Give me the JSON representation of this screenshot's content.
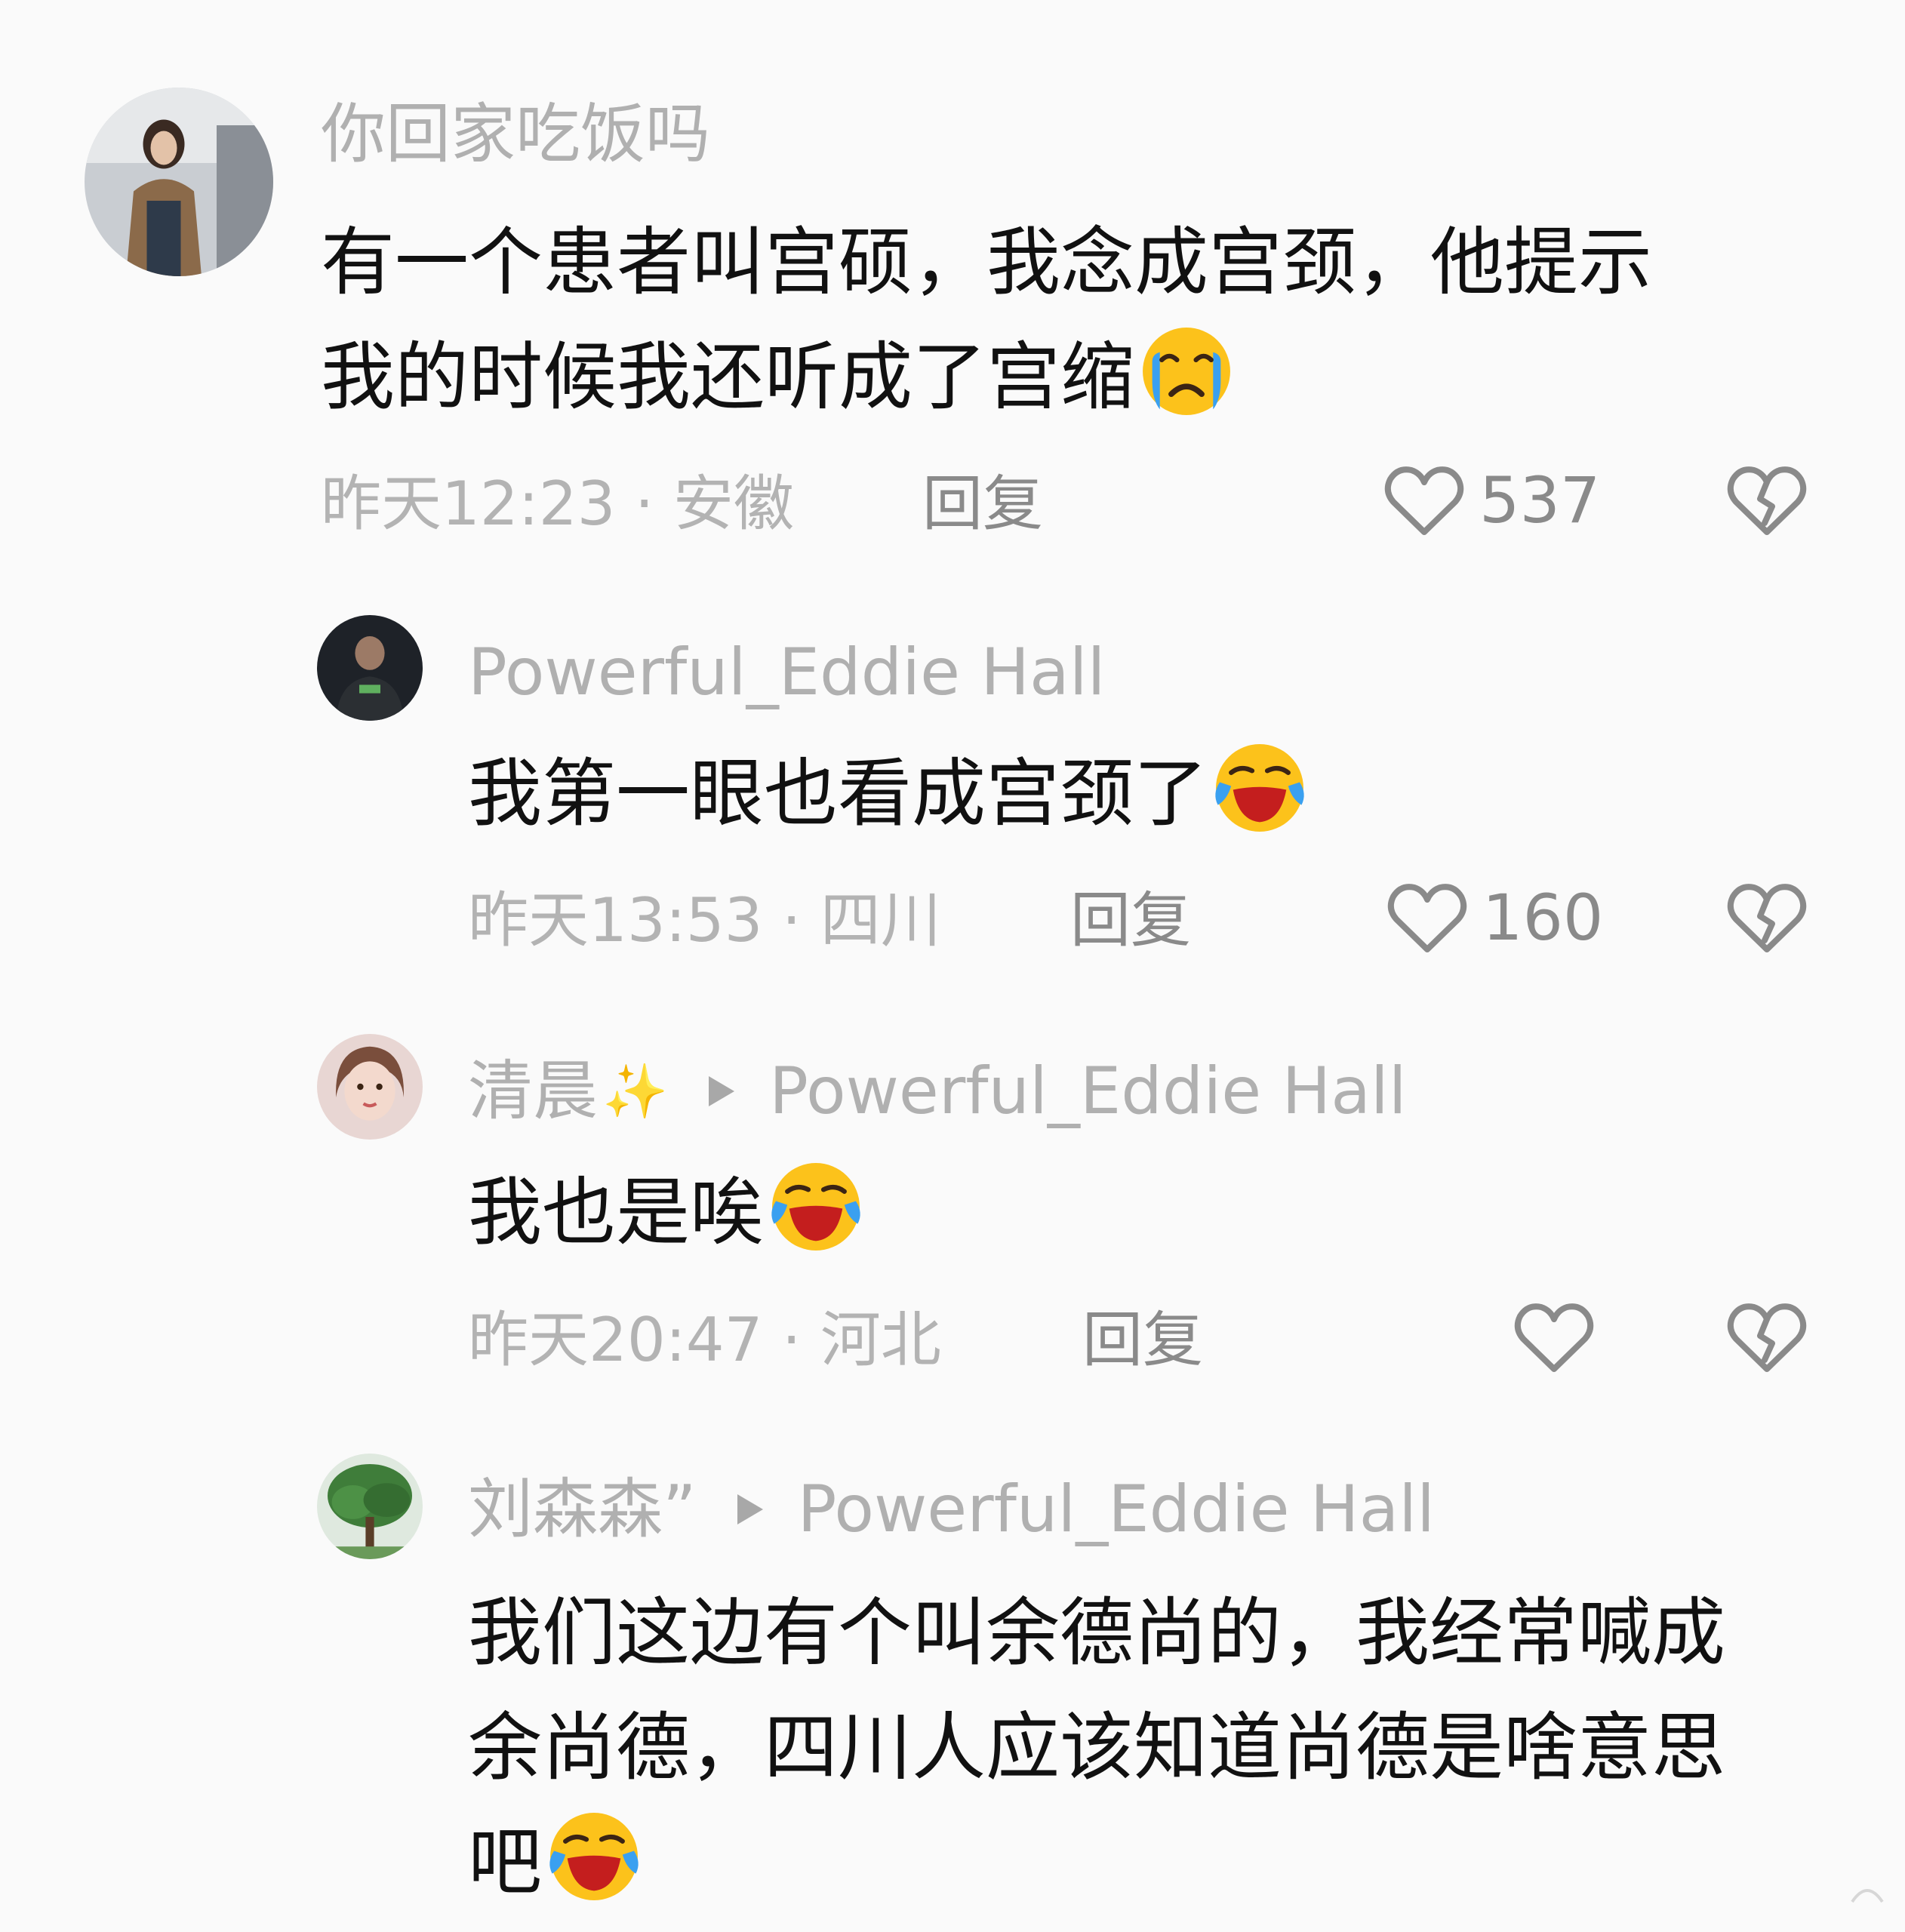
{
  "colors": {
    "background": "#fafafa",
    "username": "#b0b0b0",
    "body_text": "#111111",
    "meta": "#b3b3b3",
    "action": "#8a8a8a"
  },
  "comments": [
    {
      "username": "你回家吃饭吗",
      "text_lines": [
        "有一个患者叫宫硕，我念成宫颈，他提示",
        "我的时候我还听成了宫缩"
      ],
      "emoji": "loudly-crying-face-icon",
      "meta": "昨天12:23 · 安徽",
      "reply_label": "回复",
      "likes": "537"
    },
    {
      "username": "Powerful_Eddie Hall",
      "text_lines": [
        "我第一眼也看成宫颈了"
      ],
      "emoji": "rolling-laughing-face-icon",
      "meta": "昨天13:53 · 四川",
      "reply_label": "回复",
      "likes": "160"
    },
    {
      "username": "清晨",
      "username_suffix": "✨",
      "reply_to": "Powerful_Eddie Hall",
      "text_lines": [
        "我也是唉"
      ],
      "emoji": "rolling-laughing-face-icon",
      "meta": "昨天20:47 · 河北",
      "reply_label": "回复",
      "likes": ""
    },
    {
      "username": "刘森森”",
      "reply_to": "Powerful_Eddie Hall",
      "text_lines": [
        "我们这边有个叫余德尚的，我经常喊成",
        "余尚德，四川人应该知道尚德是啥意思",
        "吧"
      ],
      "emoji": "rolling-laughing-face-icon"
    }
  ]
}
